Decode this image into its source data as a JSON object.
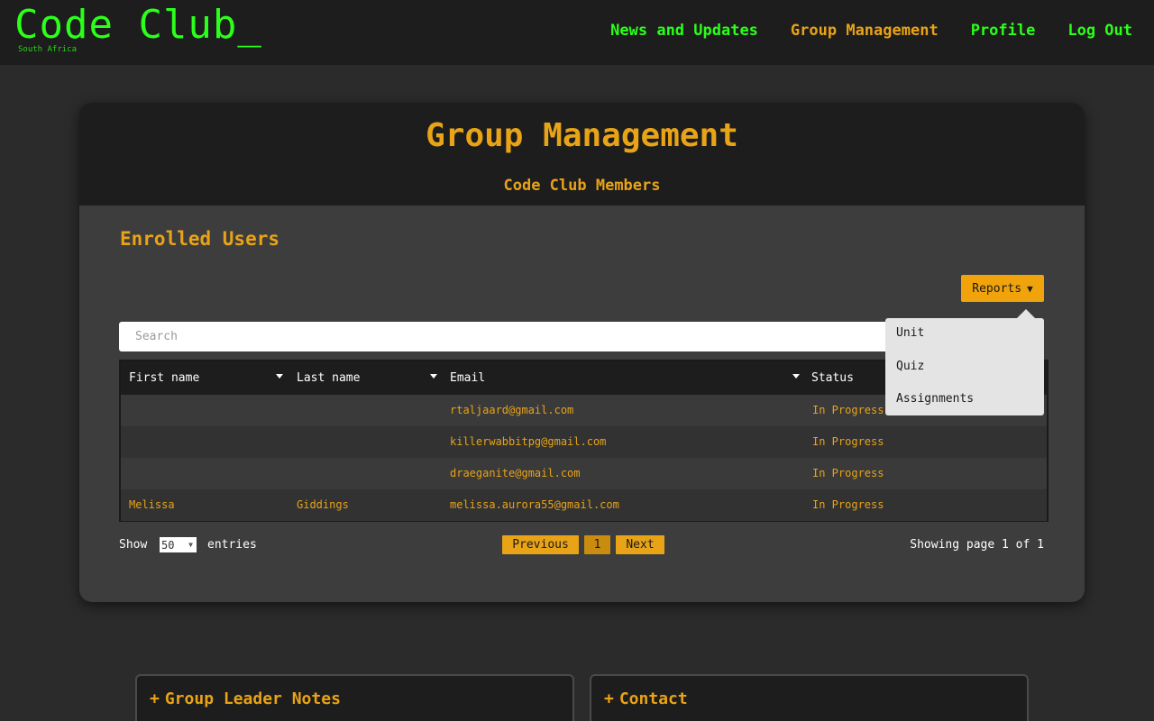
{
  "brand": {
    "title": "Code Club_",
    "subtitle": "South Africa"
  },
  "nav": {
    "items": [
      "News and Updates",
      "Group Management",
      "Profile",
      "Log Out"
    ],
    "active": "Group Management"
  },
  "header": {
    "title": "Group Management",
    "subtitle": "Code Club Members"
  },
  "section": {
    "title": "Enrolled Users"
  },
  "reports": {
    "label": "Reports",
    "icon": "caret-down-icon",
    "menu": [
      "Unit",
      "Quiz",
      "Assignments"
    ]
  },
  "search": {
    "placeholder": "Search",
    "value": ""
  },
  "table": {
    "columns": [
      "First name",
      "Last name",
      "Email",
      "Status"
    ],
    "rows": [
      {
        "first": "",
        "last": "",
        "email": "rtaljaard@gmail.com",
        "status": "In Progress"
      },
      {
        "first": "",
        "last": "",
        "email": "killerwabbitpg@gmail.com",
        "status": "In Progress"
      },
      {
        "first": "",
        "last": "",
        "email": "draeganite@gmail.com",
        "status": "In Progress"
      },
      {
        "first": "Melissa",
        "last": "Giddings",
        "email": "melissa.aurora55@gmail.com",
        "status": "In Progress"
      }
    ]
  },
  "footer": {
    "show_label": "Show",
    "entries_value": "50",
    "entries_label": "entries",
    "prev_label": "Previous",
    "page": "1",
    "next_label": "Next",
    "page_info": "Showing page 1 of 1"
  },
  "panels": {
    "notes_title": "Group Leader Notes",
    "contact_title": "Contact"
  },
  "colors": {
    "accent": "#e8a317",
    "nav_green": "#2bff1a",
    "background": "#2b2b2b",
    "card": "#3d3d3d",
    "header": "#1d1d1d"
  }
}
